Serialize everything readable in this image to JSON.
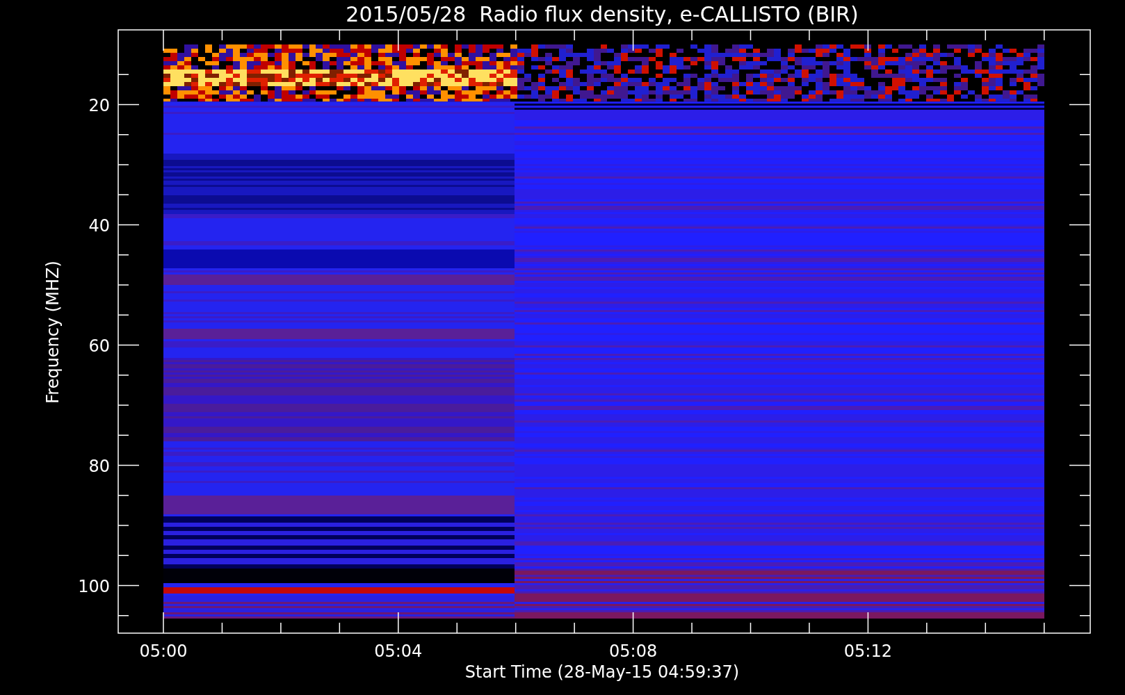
{
  "title": "2015/05/28  Radio flux density, e-CALLISTO (BIR)",
  "y_axis": {
    "label": "Frequency (MHZ)",
    "tick_labels": [
      "20",
      "40",
      "60",
      "80",
      "100"
    ]
  },
  "x_axis": {
    "label": "Start Time (28-May-15 04:59:37)",
    "tick_labels": [
      "05:00",
      "05:04",
      "05:08",
      "05:12"
    ]
  }
}
